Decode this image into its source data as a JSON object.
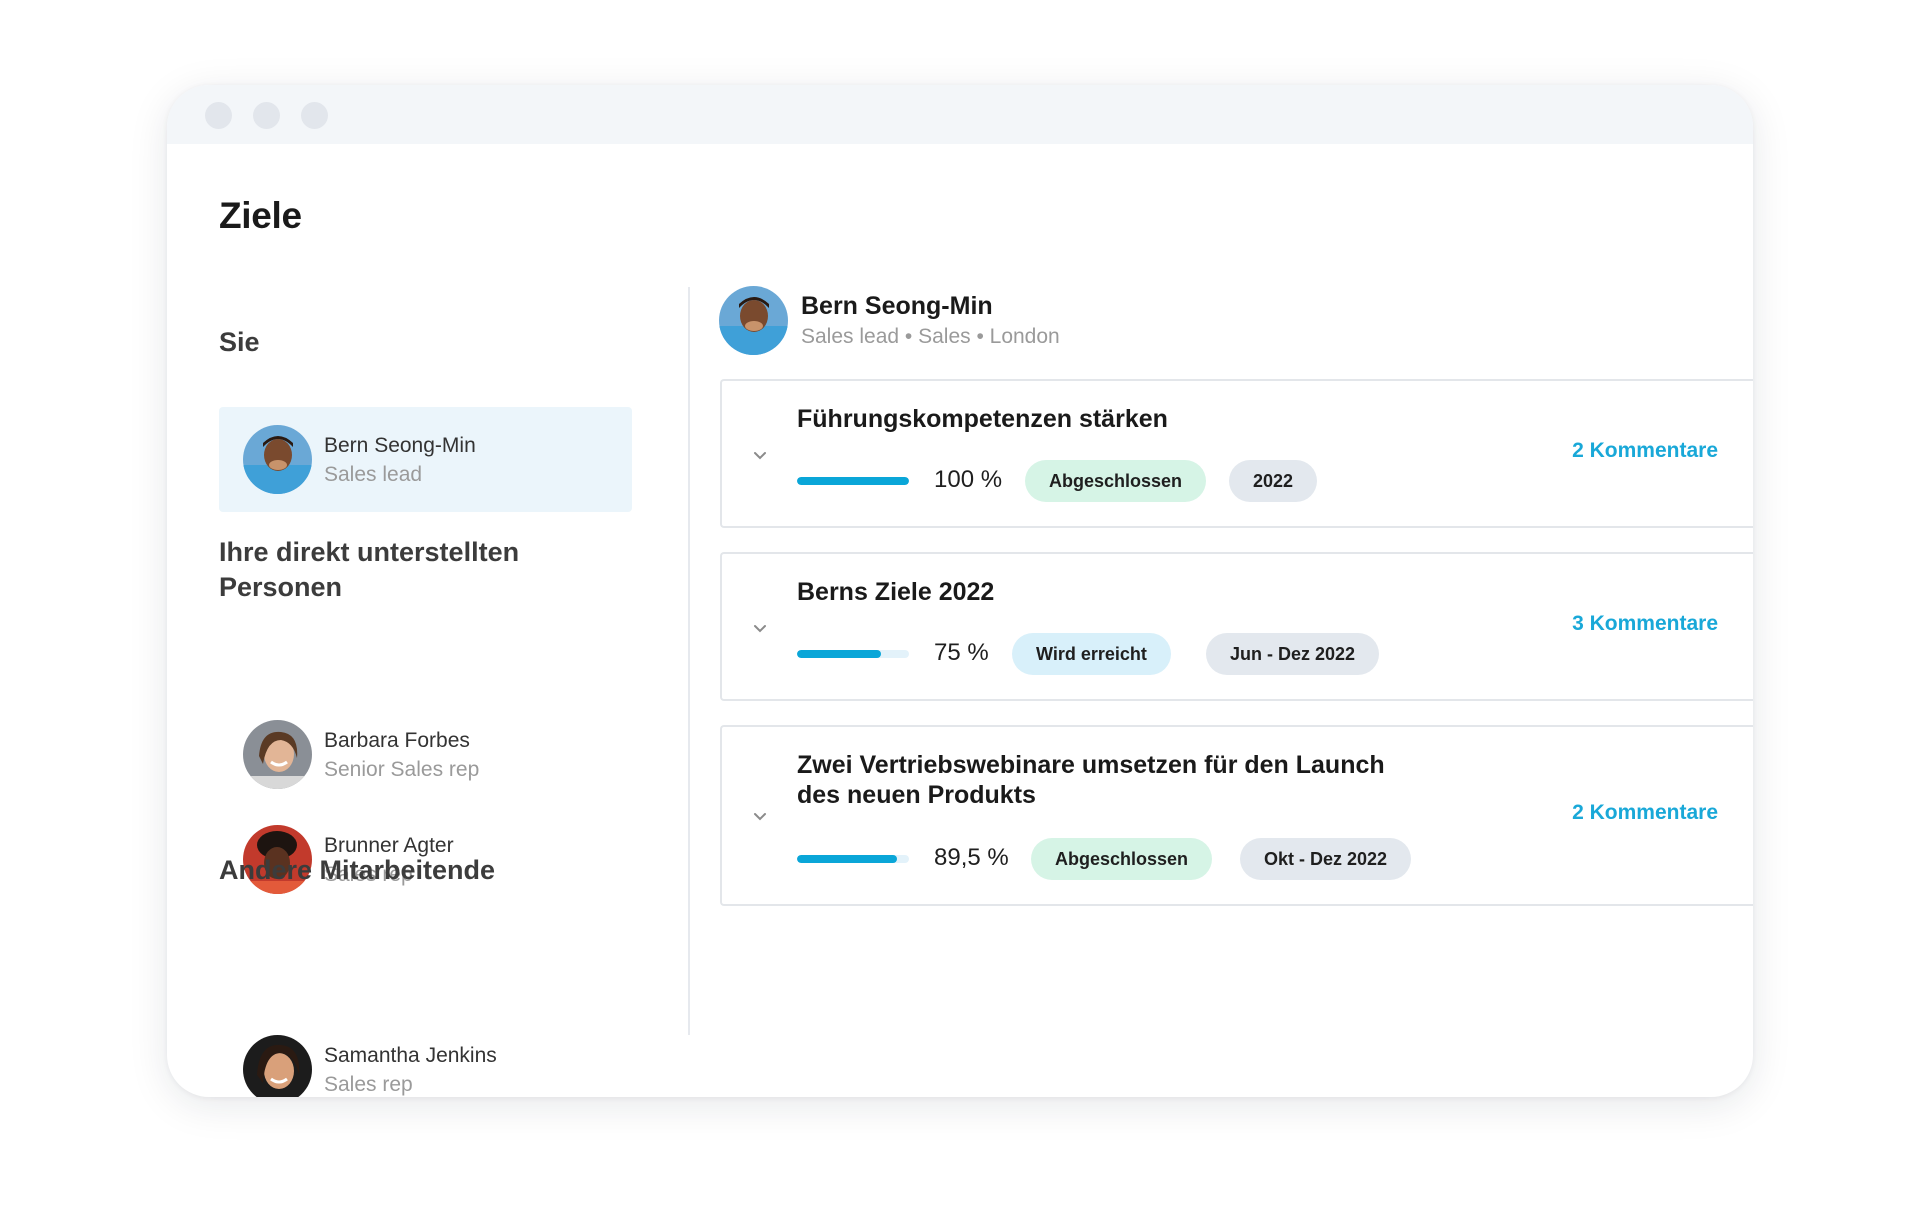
{
  "page": {
    "title": "Ziele"
  },
  "sidebar": {
    "you_heading": "Sie",
    "you": {
      "name": "Bern Seong-Min",
      "role": "Sales lead"
    },
    "reports_heading": "Ihre direkt unterstellten Personen",
    "reports": [
      {
        "name": "Barbara Forbes",
        "role": "Senior Sales rep"
      },
      {
        "name": "Brunner Agter",
        "role": "Sales rep"
      }
    ],
    "others_heading": "Andere Mitarbeitende",
    "others": [
      {
        "name": "Samantha Jenkins",
        "role": "Sales rep"
      }
    ]
  },
  "owner": {
    "name": "Bern Seong-Min",
    "meta": "Sales lead • Sales • London"
  },
  "goals": [
    {
      "title": "Führungskompetenzen stärken",
      "progress": 1.0,
      "progress_text": "100 %",
      "status": "Abgeschlossen",
      "status_color": "#d6f4e6",
      "period": "2022",
      "comments": "2 Kommentare"
    },
    {
      "title": "Berns Ziele 2022",
      "progress": 0.75,
      "progress_text": "75 %",
      "status": "Wird erreicht",
      "status_color": "#d8f0fa",
      "period": "Jun - Dez 2022",
      "comments": "3 Kommentare"
    },
    {
      "title_line1": "Zwei Vertriebswebinare umsetzen für den Launch",
      "title_line2": "des neuen Produkts",
      "progress": 0.895,
      "progress_text": "89,5 %",
      "status": "Abgeschlossen",
      "status_color": "#d6f4e6",
      "period": "Okt - Dez 2022",
      "comments": "2 Kommentare"
    }
  ],
  "colors": {
    "accent": "#19a8d8",
    "progress_fill": "#0aa6d8",
    "selected_bg": "#ebf5fb"
  },
  "icons": [
    "chevron-down-icon",
    "avatar"
  ]
}
